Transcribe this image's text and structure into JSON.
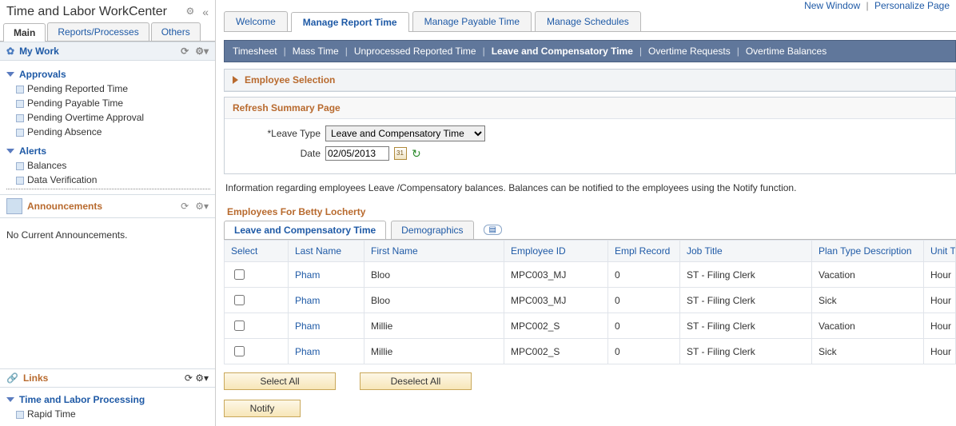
{
  "header": {
    "title": "Time and Labor WorkCenter",
    "new_window": "New Window",
    "personalize": "Personalize Page"
  },
  "left_tabs": [
    {
      "label": "Main",
      "active": true
    },
    {
      "label": "Reports/Processes",
      "active": false
    },
    {
      "label": "Others",
      "active": false
    }
  ],
  "mywork": {
    "title": "My Work",
    "groups": [
      {
        "label": "Approvals",
        "items": [
          "Pending Reported Time",
          "Pending Payable Time",
          "Pending Overtime Approval",
          "Pending Absence"
        ]
      },
      {
        "label": "Alerts",
        "items": [
          "Balances",
          "Data Verification"
        ]
      }
    ]
  },
  "announcements": {
    "title": "Announcements",
    "none": "No Current Announcements."
  },
  "links": {
    "title": "Links",
    "group": "Time and Labor Processing",
    "items": [
      "Rapid Time"
    ]
  },
  "page_tabs": [
    {
      "label": "Welcome",
      "active": false
    },
    {
      "label": "Manage Report Time",
      "active": true
    },
    {
      "label": "Manage Payable Time",
      "active": false
    },
    {
      "label": "Manage Schedules",
      "active": false
    }
  ],
  "nav_band": [
    {
      "label": "Timesheet",
      "active": false
    },
    {
      "label": "Mass Time",
      "active": false
    },
    {
      "label": "Unprocessed Reported Time",
      "active": false
    },
    {
      "label": "Leave and Compensatory Time",
      "active": true
    },
    {
      "label": "Overtime Requests",
      "active": false
    },
    {
      "label": "Overtime Balances",
      "active": false
    }
  ],
  "employee_selection": {
    "label": "Employee Selection"
  },
  "refresh": {
    "title": "Refresh Summary Page",
    "leave_type_label": "Leave Type",
    "leave_type_value": "Leave and Compensatory Time",
    "date_label": "Date",
    "date_value": "02/05/2013"
  },
  "info_text": "Information regarding employees Leave /Compensatory balances. Balances can be notified to the employees using the Notify function.",
  "emp_title": "Employees For Betty Locherty",
  "grid_tabs": [
    {
      "label": "Leave and Compensatory Time",
      "active": true
    },
    {
      "label": "Demographics",
      "active": false
    }
  ],
  "grid": {
    "columns": [
      "Select",
      "Last Name",
      "First Name",
      "Employee ID",
      "Empl Record",
      "Job Title",
      "Plan Type Description",
      "Unit T"
    ],
    "rows": [
      {
        "last": "Pham",
        "first": "Bloo",
        "emplid": "MPC003_MJ",
        "rcd": "0",
        "job": "ST - Filing Clerk",
        "plan": "Vacation",
        "unit": "Hour"
      },
      {
        "last": "Pham",
        "first": "Bloo",
        "emplid": "MPC003_MJ",
        "rcd": "0",
        "job": "ST - Filing Clerk",
        "plan": "Sick",
        "unit": "Hour"
      },
      {
        "last": "Pham",
        "first": "Millie",
        "emplid": "MPC002_S",
        "rcd": "0",
        "job": "ST - Filing Clerk",
        "plan": "Vacation",
        "unit": "Hour"
      },
      {
        "last": "Pham",
        "first": "Millie",
        "emplid": "MPC002_S",
        "rcd": "0",
        "job": "ST - Filing Clerk",
        "plan": "Sick",
        "unit": "Hour"
      }
    ]
  },
  "buttons": {
    "select_all": "Select All",
    "deselect_all": "Deselect All",
    "notify": "Notify"
  }
}
